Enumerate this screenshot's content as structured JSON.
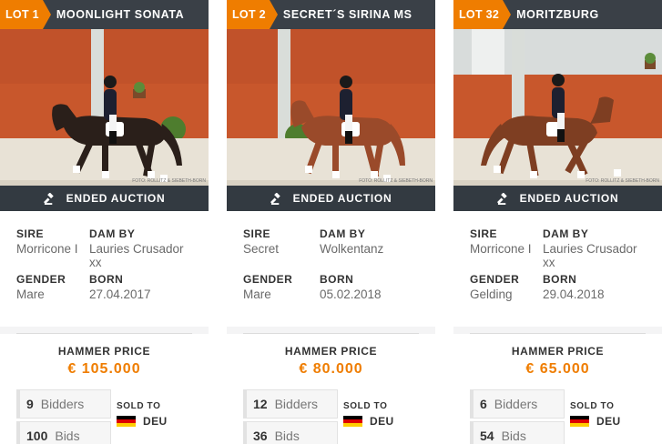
{
  "labels": {
    "ended": "ENDED AUCTION",
    "sire": "SIRE",
    "dam_by": "DAM BY",
    "gender": "GENDER",
    "born": "BORN",
    "hammer_price": "HAMMER PRICE",
    "bidders": "Bidders",
    "bids": "Bids",
    "sold_to": "SOLD TO"
  },
  "colors": {
    "accent": "#ef7d00",
    "header": "#3a4047",
    "ended_bar": "#333a41"
  },
  "icons": {
    "ended": "gavel-icon",
    "flag": "germany-flag-icon"
  },
  "lots": [
    {
      "lot": "LOT 1",
      "name": "MOONLIGHT SONATA",
      "horse_color": "dark-bay",
      "photo_credit": "FOTO: ROLLITZ & SIEBETH-BORN",
      "sire": "Morricone I",
      "dam_by": "Lauries Crusador xx",
      "gender": "Mare",
      "born": "27.04.2017",
      "hammer_price": "€ 105.000",
      "bidders": "9",
      "bids": "100",
      "sold_to": "DEU"
    },
    {
      "lot": "LOT 2",
      "name": "SECRET´S SIRINA MS",
      "horse_color": "chestnut",
      "photo_credit": "FOTO: ROLLITZ & SIEBETH-BORN",
      "sire": "Secret",
      "dam_by": "Wolkentanz",
      "gender": "Mare",
      "born": "05.02.2018",
      "hammer_price": "€ 80.000",
      "bidders": "12",
      "bids": "36",
      "sold_to": "DEU"
    },
    {
      "lot": "LOT 32",
      "name": "MORITZBURG",
      "horse_color": "bay",
      "photo_credit": "FOTO: ROLLITZ & SIEBETH-BORN",
      "sire": "Morricone I",
      "dam_by": "Lauries Crusador xx",
      "gender": "Gelding",
      "born": "29.04.2018",
      "hammer_price": "€ 65.000",
      "bidders": "6",
      "bids": "54",
      "sold_to": "DEU"
    }
  ]
}
